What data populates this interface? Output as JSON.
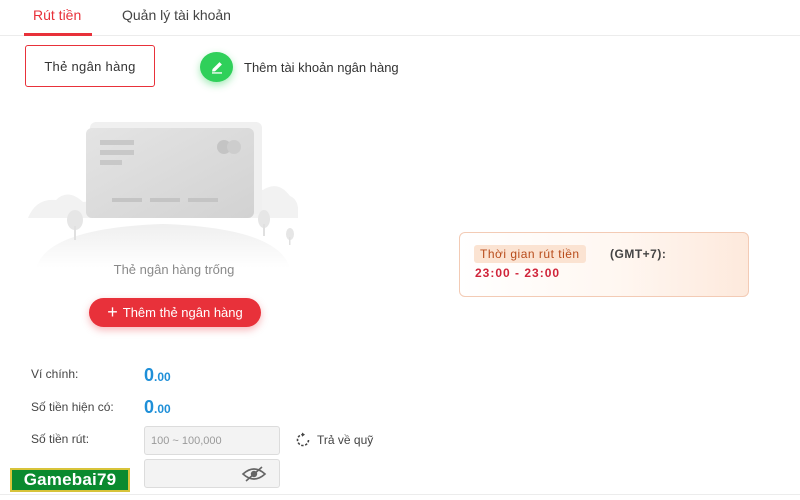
{
  "tabs": [
    {
      "label": "Rút tiền",
      "active": true
    },
    {
      "label": "Quản lý tài khoản",
      "active": false
    }
  ],
  "card_type_button": "Thẻ ngân hàng",
  "add_account": {
    "label": "Thêm tài khoản ngân hàng",
    "icon": "pencil-icon"
  },
  "empty_state": {
    "label": "Thẻ ngân hàng trống"
  },
  "add_card_button": "Thêm thẻ ngân hàng",
  "withdraw_time": {
    "label": "Thời gian rút tiền",
    "timezone": "(GMT+7):",
    "range": "23:00 - 23:00"
  },
  "form": {
    "main_wallet_label": "Ví chính:",
    "main_wallet_int": "0",
    "main_wallet_dec": ".00",
    "balance_label": "Số tiền hiện có:",
    "balance_int": "0",
    "balance_dec": ".00",
    "withdraw_label": "Số tiền rút:",
    "withdraw_placeholder": "100 ~ 100,000",
    "return_fund": "Trả về quỹ"
  },
  "watermark": "Gamebai79",
  "colors": {
    "accent": "#e8313a",
    "amount": "#1e8fd8",
    "green": "#2fd05a"
  }
}
